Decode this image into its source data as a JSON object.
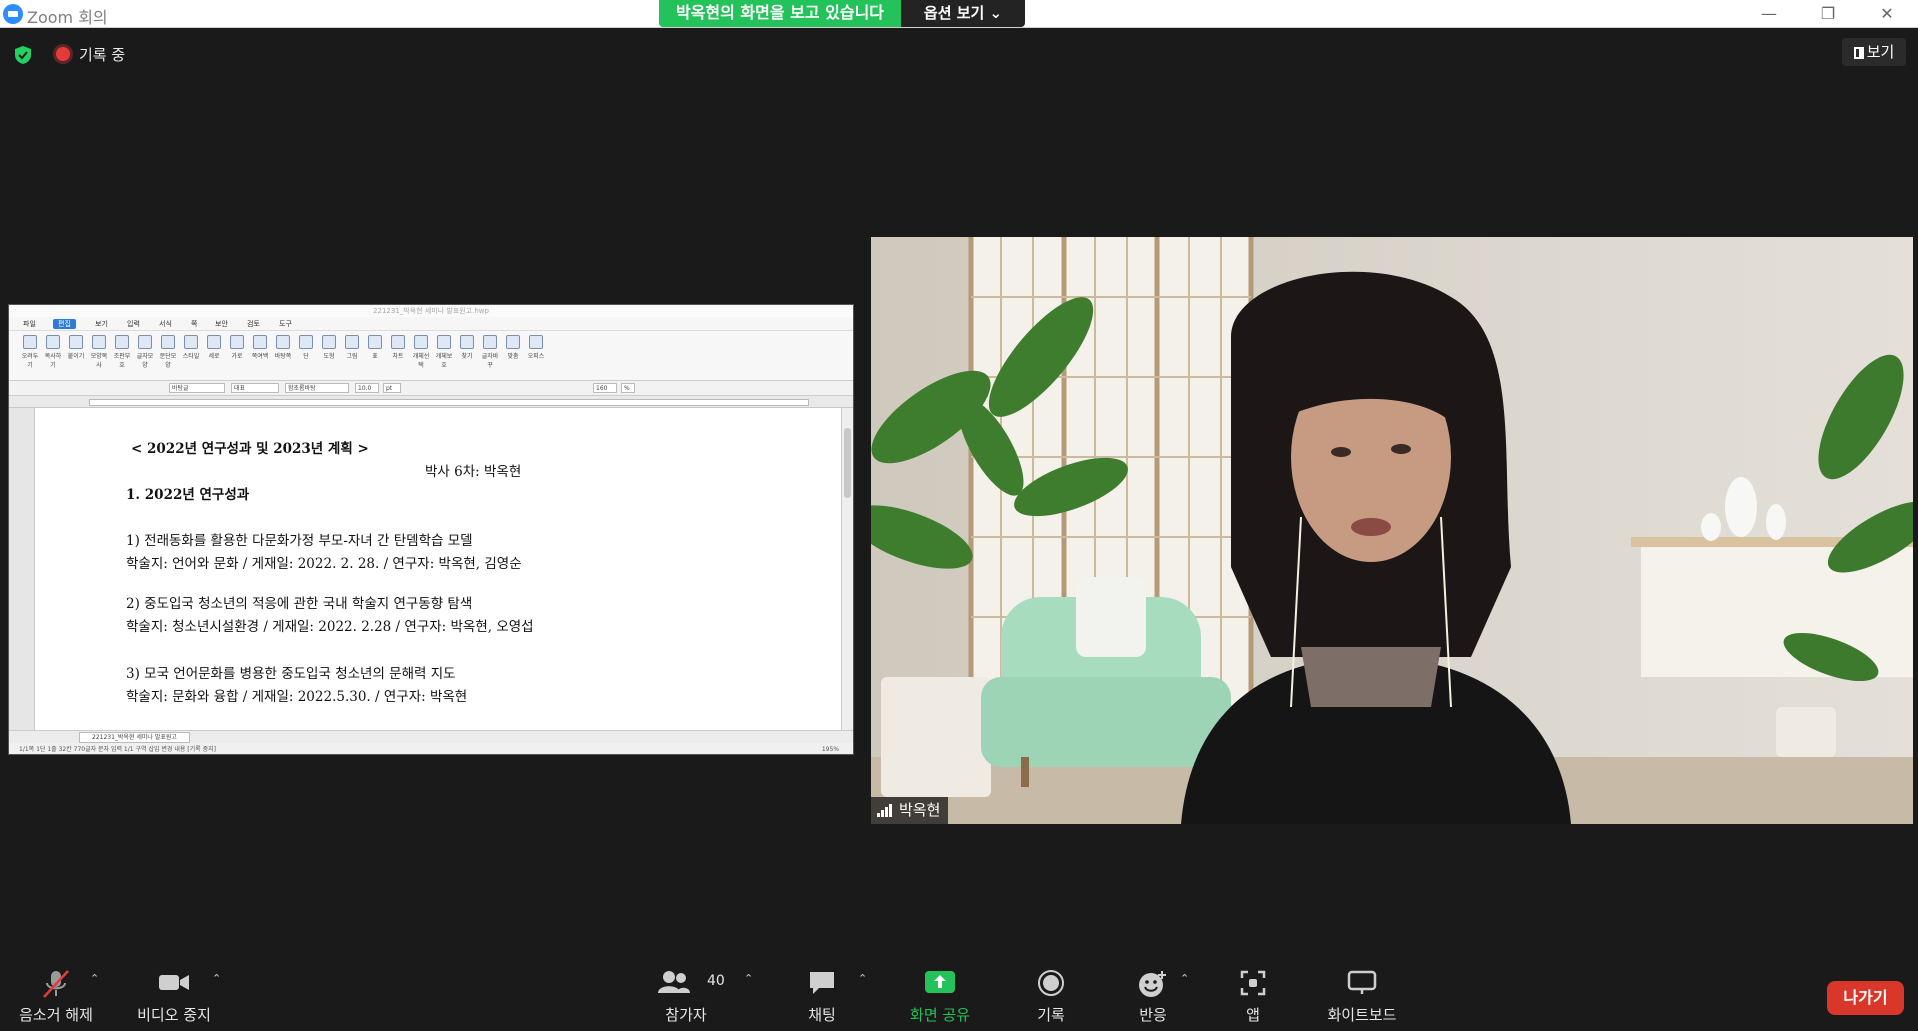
{
  "window": {
    "title": "Zoom 회의",
    "viewing_banner": "박옥현의 화면을 보고 있습니다",
    "view_options": "옵션 보기 ⌄"
  },
  "status": {
    "recording": "기록 중",
    "view_button": "보기"
  },
  "shared_screen": {
    "hwp_title": "221231_박옥현 세미나 발표원고.hwp",
    "menus": [
      "파일",
      "편집",
      "보기",
      "입력",
      "서식",
      "쪽",
      "보안",
      "검토",
      "도구"
    ],
    "active_menu_index": 1,
    "ribbon": [
      "오려두기",
      "복사하기",
      "붙이기",
      "모양복사",
      "조판부호지우기",
      "글자모양",
      "문단모양",
      "스타일",
      "세로",
      "가로",
      "쪽여백",
      "바탕쪽",
      "단",
      "도형",
      "그림",
      "표",
      "차트",
      "개체선택",
      "개체보호",
      "찾기",
      "글자바꾸기",
      "맞춤",
      "오피스 커뮤니케이터"
    ],
    "format": {
      "style": "바탕글",
      "lang": "대표",
      "font": "함초롬바탕",
      "size": "10.0",
      "unit": "pt",
      "zoom": "160",
      "percent": "%"
    },
    "document_lines": [
      "< 2022년 연구성과 및 2023년 계획 >",
      "박사 6차: 박옥현",
      "1. 2022년 연구성과",
      "1) 전래동화를 활용한 다문화가정 부모-자녀 간 탄뎀학습 모델",
      "학술지: 언어와 문화 / 게재일: 2022. 2. 28. / 연구자: 박옥현, 김영순",
      "2) 중도입국 청소년의 적응에 관한 국내 학술지 연구동향 탐색",
      "학술지: 청소년시설환경 / 게재일: 2022. 2.28 / 연구자: 박옥현, 오영섭",
      "3) 모국 언어문화를 병용한 중도입국 청소년의 문해력 지도",
      "학술지: 문화와 융합 / 게재일: 2022.5.30. / 연구자: 박옥현"
    ],
    "tab": "221231_박옥현 세미나 발표원고",
    "statusbar": "1/1쪽   1단   1줄   32칸   770글자   문자 입력   1/1 구역   삽입   변경 내용 [기록 중지]",
    "zoom_level": "195%"
  },
  "participant": {
    "name": "박옥현"
  },
  "toolbar": {
    "mute": "음소거 해제",
    "video": "비디오 중지",
    "participants": "참가자",
    "participant_count": "40",
    "chat": "채팅",
    "share": "화면 공유",
    "record": "기록",
    "reactions": "반응",
    "apps": "앱",
    "whiteboard": "화이트보드",
    "leave": "나가기"
  },
  "colors": {
    "banner_green": "#24c25a",
    "share_green": "#24c25a",
    "leave_red": "#d9372a",
    "recording_red": "#e33b3b",
    "shield_green": "#23d160"
  }
}
